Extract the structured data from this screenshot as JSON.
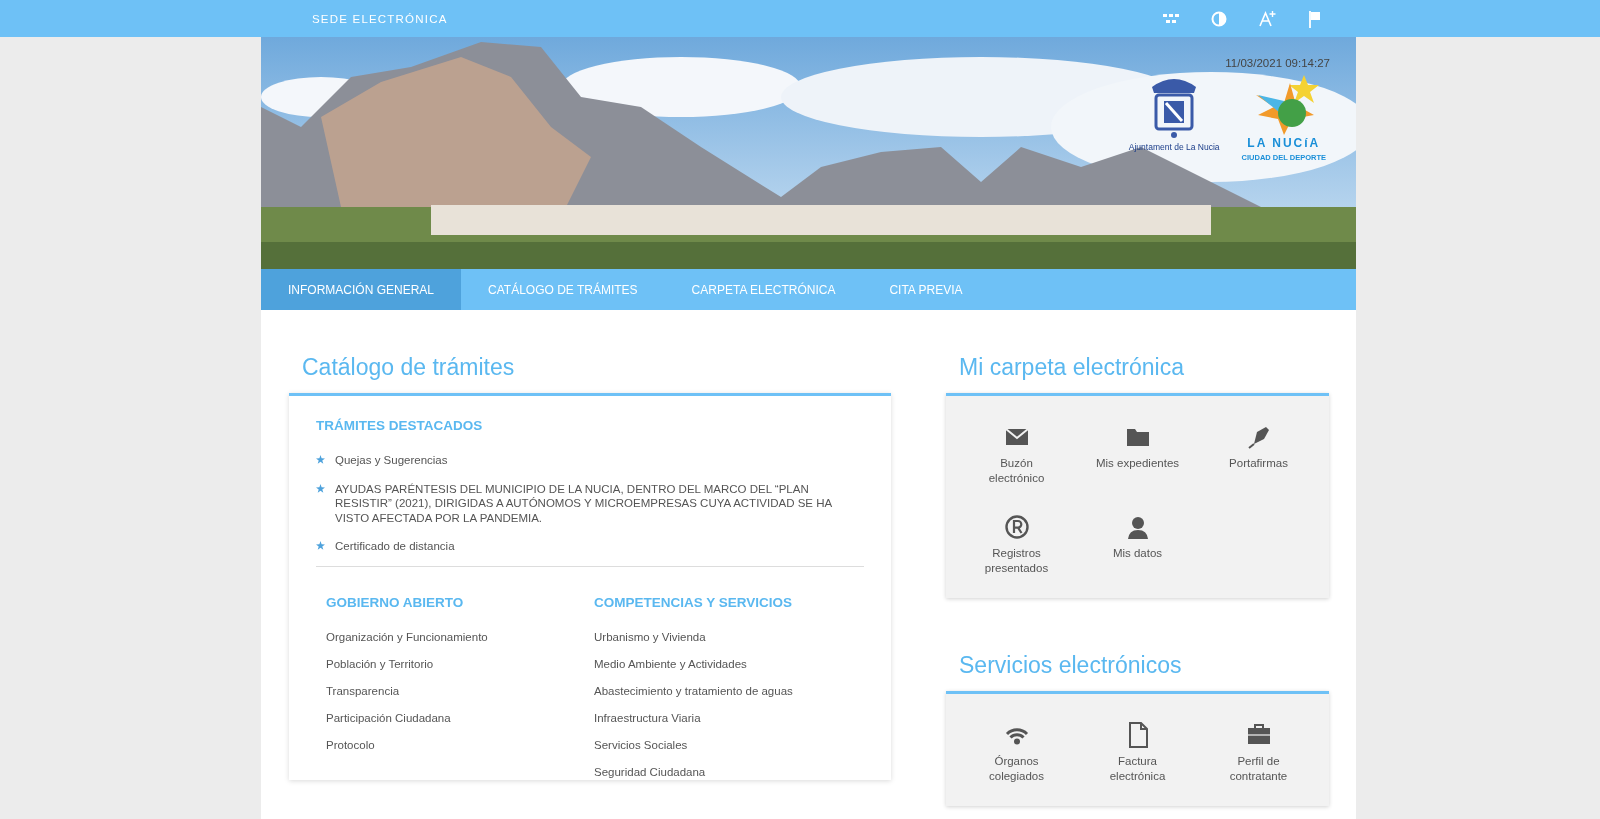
{
  "top_bar": {
    "title": "SEDE ELECTRÓNICA"
  },
  "header": {
    "datetime": "11/03/2021 09:14:27",
    "council_caption": "Ajuntament de La Nucia",
    "brand_name": "LA NUCíA",
    "brand_tagline": "CIUDAD DEL DEPORTE"
  },
  "nav": {
    "tabs": [
      {
        "label": "INFORMACIÓN GENERAL",
        "selected": true
      },
      {
        "label": "CATÁLOGO DE TRÁMITES",
        "selected": false
      },
      {
        "label": "CARPETA ELECTRÓNICA",
        "selected": false
      },
      {
        "label": "CITA PREVIA",
        "selected": false
      }
    ]
  },
  "catalog": {
    "title": "Catálogo de trámites",
    "featured_heading": "TRÁMITES DESTACADOS",
    "featured_items": [
      "Quejas y Sugerencias",
      "AYUDAS PARÉNTESIS DEL MUNICIPIO DE LA NUCIA, DENTRO DEL MARCO DEL “PLAN RESISTIR” (2021), DIRIGIDAS A AUTÓNOMOS Y MICROEMPRESAS CUYA ACTIVIDAD SE HA VISTO AFECTADA POR LA PANDEMIA.",
      "Certificado de distancia"
    ],
    "sections": [
      {
        "heading": "GOBIERNO ABIERTO",
        "links": [
          "Organización y Funcionamiento",
          "Población y Territorio",
          "Transparencia",
          "Participación Ciudadana",
          "Protocolo"
        ]
      },
      {
        "heading": "COMPETENCIAS Y SERVICIOS",
        "links": [
          "Urbanismo y Vivienda",
          "Medio Ambiente y Actividades",
          "Abastecimiento y tratamiento de aguas",
          "Infraestructura Viaria",
          "Servicios Sociales",
          "Seguridad Ciudadana"
        ]
      }
    ]
  },
  "carpeta": {
    "title": "Mi carpeta electrónica",
    "tiles": [
      {
        "label": "Buzón electrónico",
        "kind": "mail"
      },
      {
        "label": "Mis expedientes",
        "kind": "folder"
      },
      {
        "label": "Portafirmas",
        "kind": "pen"
      },
      {
        "label": "Registros presentados",
        "kind": "registered"
      },
      {
        "label": "Mis datos",
        "kind": "user"
      }
    ]
  },
  "servicios": {
    "title": "Servicios electrónicos",
    "tiles": [
      {
        "label": "Órganos colegiados",
        "kind": "signal"
      },
      {
        "label": "Factura electrónica",
        "kind": "document"
      },
      {
        "label": "Perfil de contratante",
        "kind": "briefcase"
      }
    ]
  }
}
